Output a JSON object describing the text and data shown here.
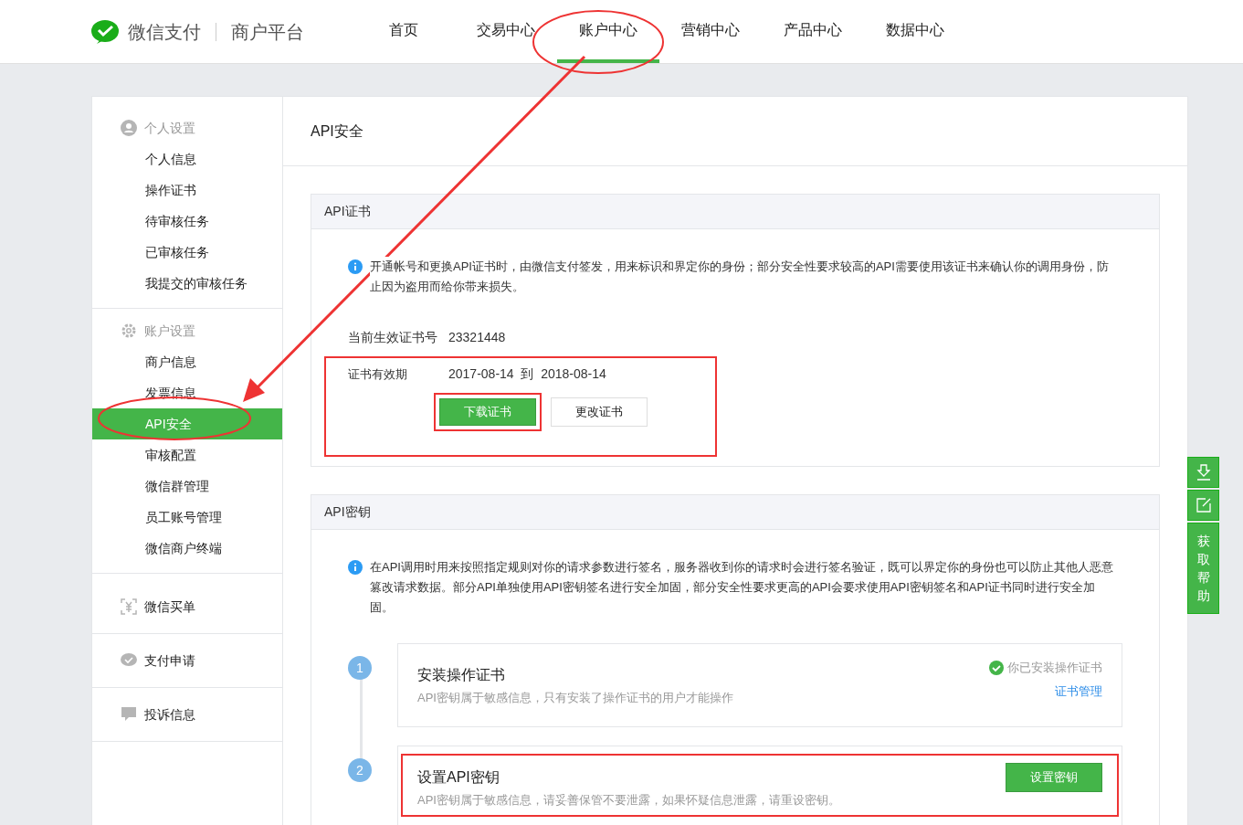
{
  "header": {
    "brand": "微信支付",
    "subtitle": "商户平台",
    "nav": [
      {
        "label": "首页",
        "selected": false
      },
      {
        "label": "交易中心",
        "selected": false
      },
      {
        "label": "账户中心",
        "selected": true
      },
      {
        "label": "营销中心",
        "selected": false
      },
      {
        "label": "产品中心",
        "selected": false
      },
      {
        "label": "数据中心",
        "selected": false
      }
    ]
  },
  "sidebar": [
    {
      "title": "个人设置",
      "kind": "group",
      "items": [
        {
          "label": "个人信息",
          "selected": false
        },
        {
          "label": "操作证书",
          "selected": false
        },
        {
          "label": "待审核任务",
          "selected": false
        },
        {
          "label": "已审核任务",
          "selected": false
        },
        {
          "label": "我提交的审核任务",
          "selected": false
        }
      ]
    },
    {
      "title": "账户设置",
      "kind": "group",
      "items": [
        {
          "label": "商户信息",
          "selected": false
        },
        {
          "label": "发票信息",
          "selected": false
        },
        {
          "label": "API安全",
          "selected": true
        },
        {
          "label": "审核配置",
          "selected": false
        },
        {
          "label": "微信群管理",
          "selected": false
        },
        {
          "label": "员工账号管理",
          "selected": false
        },
        {
          "label": "微信商户终端",
          "selected": false
        }
      ]
    },
    {
      "title": "微信买单",
      "kind": "link"
    },
    {
      "title": "支付申请",
      "kind": "link"
    },
    {
      "title": "投诉信息",
      "kind": "link"
    }
  ],
  "page_title": "API安全",
  "cert": {
    "title": "API证书",
    "info": "开通帐号和更换API证书时，由微信支付签发，用来标识和界定你的身份；部分安全性要求较高的API需要使用该证书来确认你的调用身份，防止因为盗用而给你带来损失。",
    "number_label": "当前生效证书号",
    "number": "23321448",
    "validity_label": "证书有效期",
    "from": "2017-08-14",
    "to_word": "到",
    "to": "2018-08-14",
    "buttons": [
      {
        "label": "下载证书",
        "kind": "primary"
      },
      {
        "label": "更改证书",
        "kind": "default"
      }
    ]
  },
  "key": {
    "title": "API密钥",
    "info": "在API调用时用来按照指定规则对你的请求参数进行签名，服务器收到你的请求时会进行签名验证，既可以界定你的身份也可以防止其他人恶意篡改请求数据。部分API单独使用API密钥签名进行安全加固，部分安全性要求更高的API会要求使用API密钥签名和API证书同时进行安全加固。",
    "steps": [
      {
        "number": "1",
        "title": "安装操作证书",
        "desc": "API密钥属于敏感信息，只有安装了操作证书的用户才能操作",
        "kind": "status",
        "status": "你已安装操作证书",
        "link": "证书管理"
      },
      {
        "number": "2",
        "title": "设置API密钥",
        "desc": "API密钥属于敏感信息，请妥善保管不要泄露，如果怀疑信息泄露，请重设密钥。",
        "kind": "button",
        "button": "设置密钥"
      }
    ]
  },
  "float_bar": {
    "help": "获取帮助"
  }
}
